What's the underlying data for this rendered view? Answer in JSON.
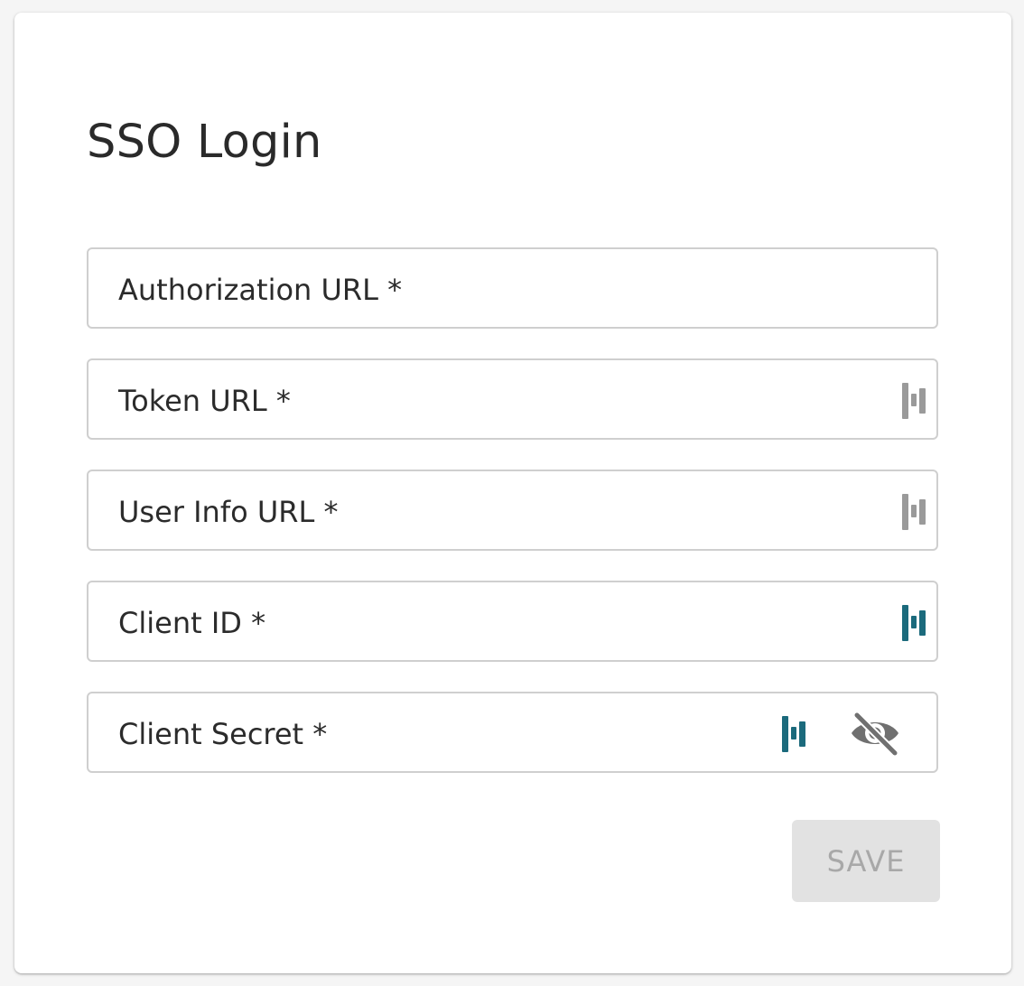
{
  "title": "SSO Login",
  "fields": [
    {
      "label": "Authorization URL *",
      "value": ""
    },
    {
      "label": "Token URL *",
      "value": "",
      "password_manager_icon": "password-manager-icon",
      "icon_color": "#9a9a9a"
    },
    {
      "label": "User Info URL *",
      "value": "",
      "password_manager_icon": "password-manager-icon",
      "icon_color": "#9a9a9a"
    },
    {
      "label": "Client ID *",
      "value": "",
      "password_manager_icon": "password-manager-icon",
      "icon_color": "#1b6a7c"
    },
    {
      "label": "Client Secret *",
      "value": "",
      "password_manager_icon": "password-manager-icon",
      "icon_color": "#1b6a7c",
      "visibility_icon": "eye-off-icon"
    }
  ],
  "save_button": {
    "label": "SAVE",
    "disabled": true
  },
  "colors": {
    "text": "#262626",
    "border": "#cfcfcf",
    "button_disabled_bg": "#e2e2e2",
    "button_disabled_text": "#a8a8a8",
    "icon_teal": "#1b6a7c",
    "icon_grey": "#9a9a9a",
    "eye_icon": "#707070"
  }
}
